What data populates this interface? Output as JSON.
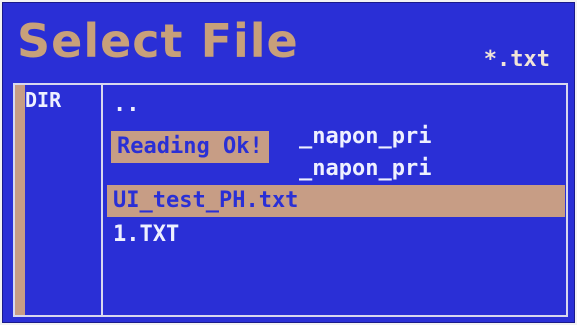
{
  "header": {
    "title": "Select File",
    "filter": "*.txt"
  },
  "sidebar": {
    "dir_label": "DIR"
  },
  "files": [
    {
      "name": "..",
      "selected": false
    },
    {
      "name": "_napon_pri",
      "selected": false
    },
    {
      "name": "_napon_pri",
      "selected": false
    },
    {
      "name": "UI_test_PH.txt",
      "selected": true
    },
    {
      "name": "1.TXT",
      "selected": false
    }
  ],
  "toast": {
    "text": "Reading Ok!"
  },
  "colors": {
    "screen_bg": "#2a2fd6",
    "accent": "#c79d85",
    "title_text": "#c8a07a",
    "text": "#eef0ff"
  }
}
